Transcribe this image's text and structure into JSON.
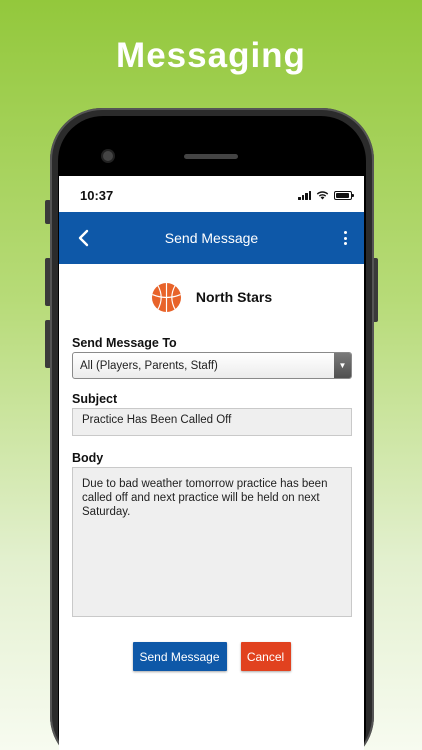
{
  "promo": {
    "title": "Messaging"
  },
  "status_bar": {
    "time": "10:37"
  },
  "nav": {
    "title": "Send Message",
    "back_icon": "chevron-left-icon",
    "more_icon": "more-vertical-icon"
  },
  "team": {
    "name": "North Stars",
    "icon": "basketball-icon"
  },
  "form": {
    "send_to": {
      "label": "Send Message To",
      "selected": "All (Players, Parents, Staff)"
    },
    "subject": {
      "label": "Subject",
      "value": "Practice Has Been Called Off"
    },
    "body": {
      "label": "Body",
      "value": "Due to bad weather tomorrow practice has been called off and next practice will be held on next Saturday."
    }
  },
  "actions": {
    "send_label": "Send Message",
    "cancel_label": "Cancel"
  },
  "colors": {
    "primary": "#0e58a8",
    "cancel": "#e1421f",
    "background": "#93c83c",
    "ball": "#e8632a"
  }
}
